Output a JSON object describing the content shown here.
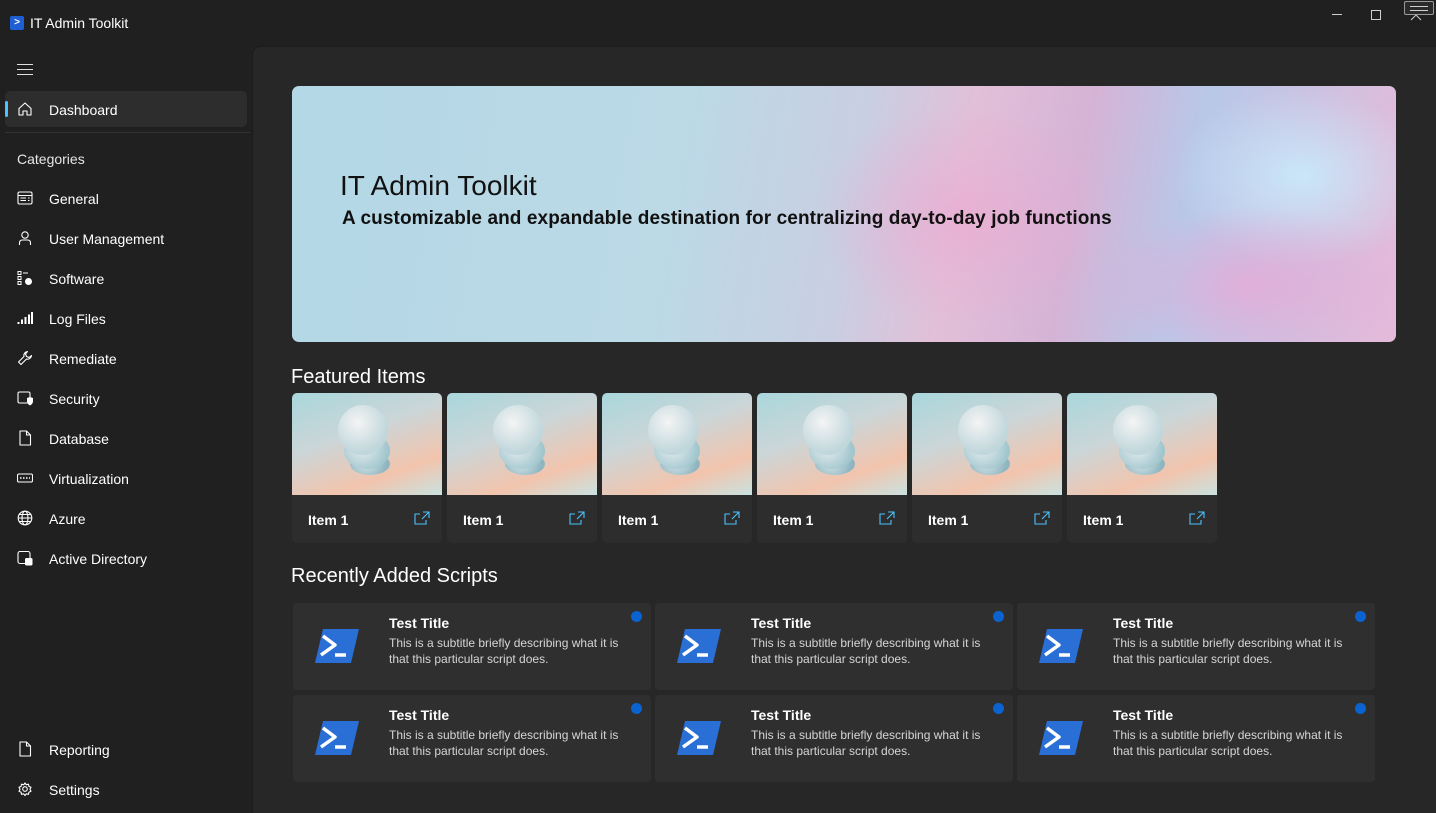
{
  "window": {
    "title": "IT Admin Toolkit"
  },
  "sidebar": {
    "dashboard": {
      "label": "Dashboard",
      "icon": "home-icon"
    },
    "categories_heading": "Categories",
    "items": [
      {
        "label": "General",
        "icon": "general-icon"
      },
      {
        "label": "User Management",
        "icon": "user-icon"
      },
      {
        "label": "Software",
        "icon": "software-icon"
      },
      {
        "label": "Log Files",
        "icon": "log-icon"
      },
      {
        "label": "Remediate",
        "icon": "wrench-icon"
      },
      {
        "label": "Security",
        "icon": "security-icon"
      },
      {
        "label": "Database",
        "icon": "document-icon"
      },
      {
        "label": "Virtualization",
        "icon": "virtualization-icon"
      },
      {
        "label": "Azure",
        "icon": "globe-icon"
      },
      {
        "label": "Active Directory",
        "icon": "directory-icon"
      }
    ],
    "footer_items": [
      {
        "label": "Reporting",
        "icon": "report-icon"
      },
      {
        "label": "Settings",
        "icon": "gear-icon"
      }
    ]
  },
  "hero": {
    "title": "IT Admin Toolkit",
    "subtitle": "A customizable and expandable destination for centralizing day-to-day job functions"
  },
  "featured": {
    "heading": "Featured Items",
    "items": [
      {
        "label": "Item 1"
      },
      {
        "label": "Item 1"
      },
      {
        "label": "Item 1"
      },
      {
        "label": "Item 1"
      },
      {
        "label": "Item 1"
      },
      {
        "label": "Item 1"
      }
    ]
  },
  "recent": {
    "heading": "Recently Added Scripts",
    "scripts": [
      {
        "title": "Test Title",
        "subtitle": "This is a subtitle briefly describing what it is that this particular script does."
      },
      {
        "title": "Test Title",
        "subtitle": "This is a subtitle briefly describing what it is that this particular script does."
      },
      {
        "title": "Test Title",
        "subtitle": "This is a subtitle briefly describing what it is that this particular script does."
      },
      {
        "title": "Test Title",
        "subtitle": "This is a subtitle briefly describing what it is that this particular script does."
      },
      {
        "title": "Test Title",
        "subtitle": "This is a subtitle briefly describing what it is that this particular script does."
      },
      {
        "title": "Test Title",
        "subtitle": "This is a subtitle briefly describing what it is that this particular script does."
      }
    ]
  },
  "colors": {
    "accent": "#4cc2ff",
    "status_dot": "#0a63d1",
    "powershell": "#2a6fd6"
  }
}
